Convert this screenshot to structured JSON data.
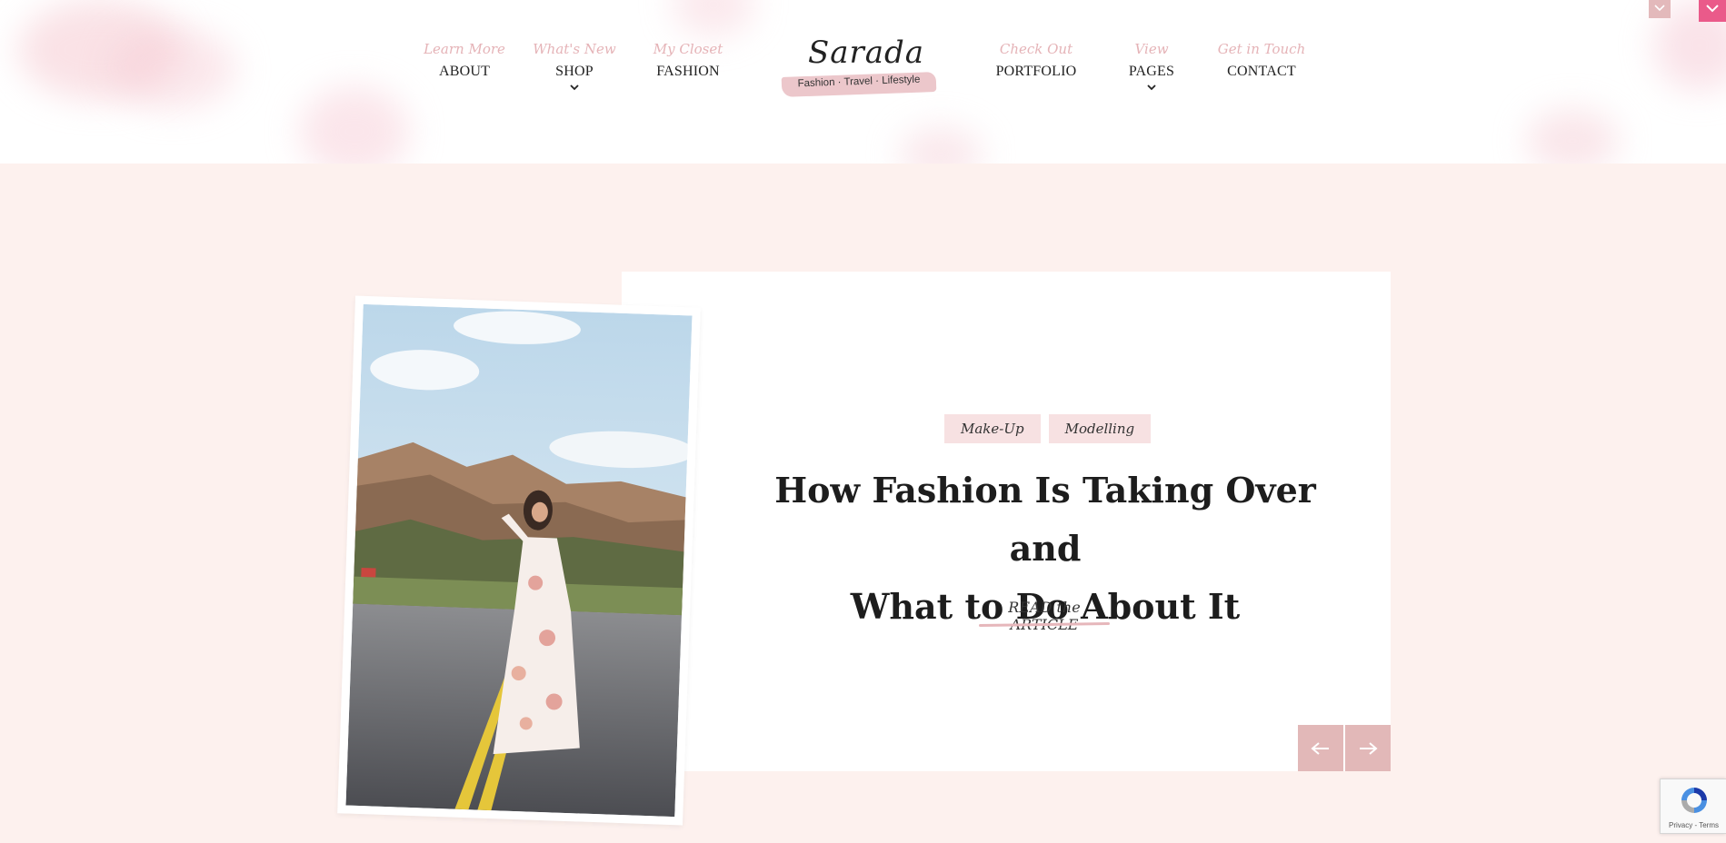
{
  "nav": {
    "left": [
      {
        "sub": "Learn More",
        "label": "ABOUT",
        "dropdown": false
      },
      {
        "sub": "What's New",
        "label": "SHOP",
        "dropdown": true
      },
      {
        "sub": "My Closet",
        "label": "FASHION",
        "dropdown": false
      }
    ],
    "right": [
      {
        "sub": "Check Out",
        "label": "PORTFOLIO",
        "dropdown": false
      },
      {
        "sub": "View",
        "label": "PAGES",
        "dropdown": true
      },
      {
        "sub": "Get in Touch",
        "label": "CONTACT",
        "dropdown": false
      }
    ]
  },
  "logo": {
    "name": "Sarada",
    "tagline": "Fashion · Travel · Lifestyle"
  },
  "hero": {
    "tags": [
      "Make-Up",
      "Modelling"
    ],
    "title_line1": "How Fashion Is Taking Over and",
    "title_line2": "What to Do About It",
    "read_link": "READ the ARTICLE",
    "prev_icon": "arrow-left-icon",
    "next_icon": "arrow-right-icon"
  },
  "recaptcha": {
    "label": "Privacy - Terms"
  },
  "colors": {
    "page_bg": "#fdf1ee",
    "accent_pink": "#e5b3b7",
    "tag_bg": "#f7e1e2",
    "arrow_bg": "#e2b8b8",
    "corner_pink": "#ea5a8a"
  }
}
